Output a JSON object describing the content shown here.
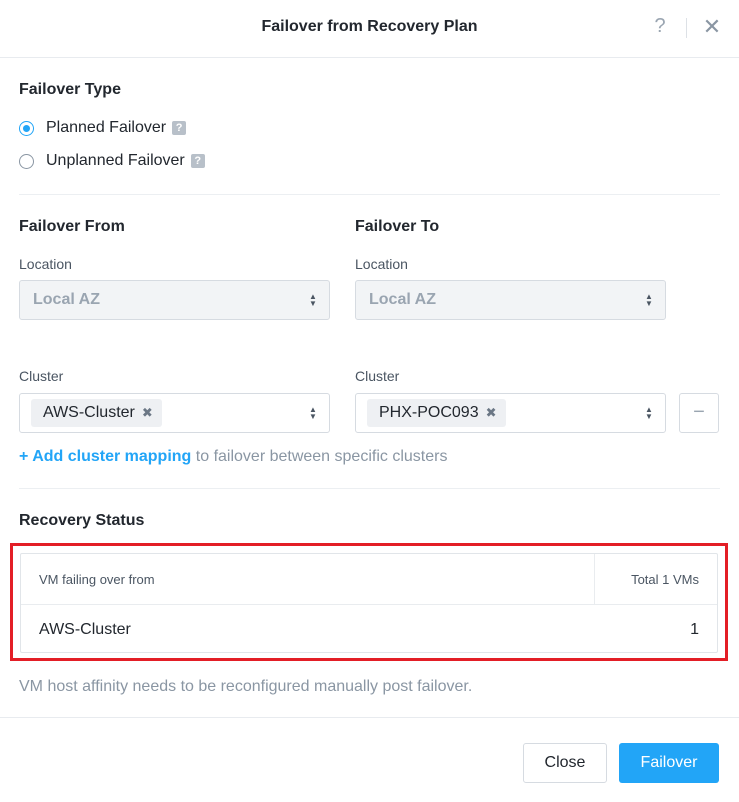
{
  "dialog": {
    "title": "Failover from Recovery Plan",
    "help_glyph": "?",
    "close_glyph": "✕"
  },
  "failover_type": {
    "title": "Failover Type",
    "options": [
      {
        "label": "Planned Failover",
        "selected": true
      },
      {
        "label": "Unplanned Failover",
        "selected": false
      }
    ],
    "help_badge": "?"
  },
  "failover_from": {
    "title": "Failover From",
    "location_label": "Location",
    "location_value": "Local AZ",
    "cluster_label": "Cluster",
    "cluster_tag": "AWS-Cluster"
  },
  "failover_to": {
    "title": "Failover To",
    "location_label": "Location",
    "location_value": "Local AZ",
    "cluster_label": "Cluster",
    "cluster_tag": "PHX-POC093"
  },
  "mapping": {
    "remove_glyph": "−",
    "add_link": "+ Add cluster mapping",
    "add_rest": " to failover between specific clusters"
  },
  "recovery_status": {
    "title": "Recovery Status",
    "columns": [
      "VM failing over from",
      "Total 1 VMs"
    ],
    "rows": [
      {
        "cluster": "AWS-Cluster",
        "count": "1"
      }
    ]
  },
  "note": "VM host affinity needs to be reconfigured manually post failover.",
  "footer": {
    "close_label": "Close",
    "failover_label": "Failover"
  },
  "colors": {
    "accent": "#22a5f7",
    "highlight_border": "#e31e26"
  },
  "icons": {
    "help": "question-mark-icon",
    "close": "close-icon",
    "select": "up-down-caret-icon",
    "tag_remove": "x-icon",
    "remove_mapping": "minus-icon"
  }
}
